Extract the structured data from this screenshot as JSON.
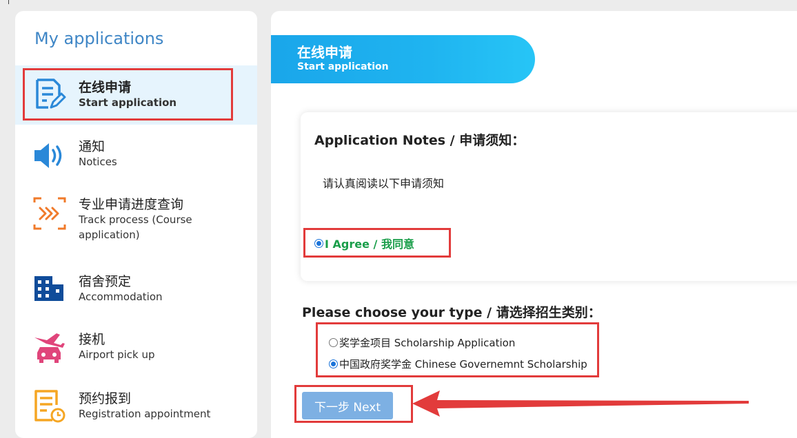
{
  "sidebar": {
    "title": "My applications",
    "items": [
      {
        "zh": "在线申请",
        "en": "Start application",
        "icon": "edit-form-icon"
      },
      {
        "zh": "通知",
        "en": "Notices",
        "icon": "speaker-icon"
      },
      {
        "zh": "专业申请进度查询",
        "en": "Track process (Course",
        "en2": "application)",
        "icon": "track-arrows-icon"
      },
      {
        "zh": "宿舍预定",
        "en": "Accommodation",
        "icon": "building-icon"
      },
      {
        "zh": "接机",
        "en": "Airport pick up",
        "icon": "airport-car-icon"
      },
      {
        "zh": "预约报到",
        "en": "Registration appointment",
        "icon": "clock-document-icon"
      }
    ]
  },
  "header": {
    "zh": "在线申请",
    "en": "Start application"
  },
  "notes": {
    "title": "Application Notes / 申请须知：",
    "body": "请认真阅读以下申请须知",
    "agree_label": "I Agree / 我同意"
  },
  "type_section": {
    "title": "Please choose your type / 请选择招生类别：",
    "options": [
      {
        "label": "奖学金项目 Scholarship Application",
        "checked": false
      },
      {
        "label": "中国政府奖学金 Chinese Governemnt Scholarship",
        "checked": true
      }
    ]
  },
  "next_button": "下一步 Next",
  "colors": {
    "accent_blue": "#1aa6ea",
    "agree_green": "#1a9e4a",
    "annotation_red": "#e23b3b",
    "sidebar_title": "#3f86c6"
  }
}
